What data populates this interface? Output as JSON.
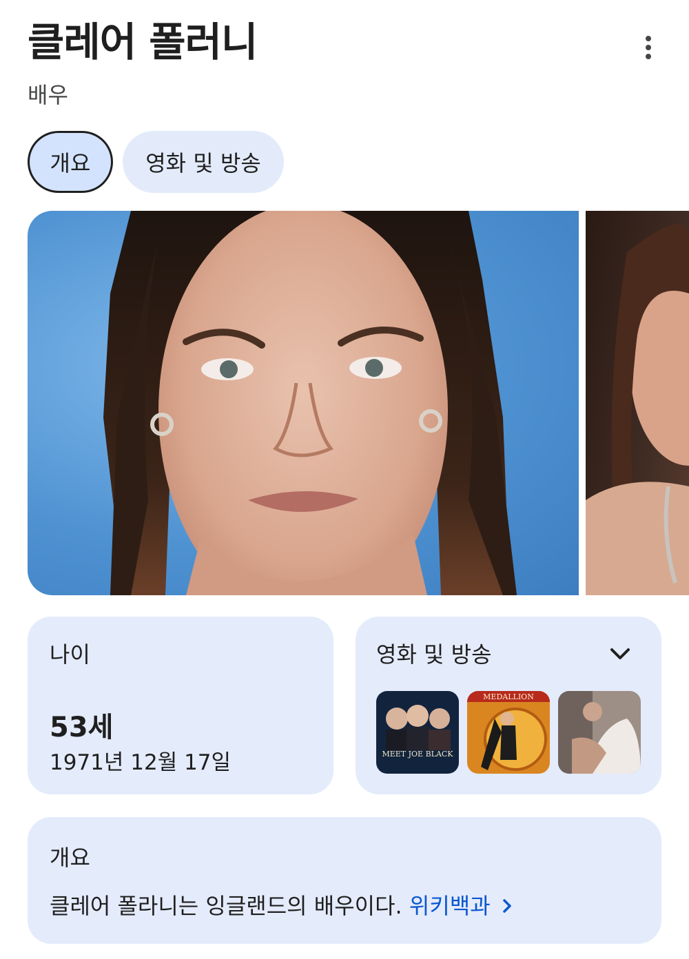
{
  "header": {
    "title": "클레어 폴러니",
    "subtitle": "배우"
  },
  "tabs": [
    {
      "label": "개요",
      "active": true
    },
    {
      "label": "영화 및 방송",
      "active": false
    }
  ],
  "age_card": {
    "label": "나이",
    "value": "53세",
    "birth_date": "1971년 12월 17일"
  },
  "films_card": {
    "label": "영화 및 방송",
    "poster_texts": [
      "MEET JOE BLACK",
      "MEDALLION"
    ]
  },
  "overview_card": {
    "label": "개요",
    "text": "클레어 폴라니는 잉글랜드의 배우이다.",
    "link": "위키백과"
  },
  "icons": {
    "more": "more-vert-icon",
    "expand": "chevron-down-icon",
    "link_arrow": "chevron-right-icon"
  },
  "colors": {
    "card_bg": "#e4ebfb",
    "chip_active_bg": "#d3e3fd",
    "link": "#0b57d0"
  }
}
